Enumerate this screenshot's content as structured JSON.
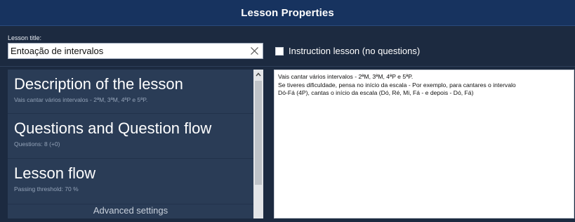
{
  "window": {
    "title": "Lesson Properties"
  },
  "lesson_title": {
    "label": "Lesson title:",
    "value": "Entoação de intervalos"
  },
  "instruction_lesson": {
    "label": "Instruction lesson (no questions)",
    "checked": false
  },
  "sections": [
    {
      "title": "Description of the lesson",
      "subtitle": "Vais cantar vários intervalos - 2ªM, 3ªM, 4ªP e 5ªP."
    },
    {
      "title": "Questions and Question flow",
      "subtitle": "Questions: 8 (+0)"
    },
    {
      "title": "Lesson flow",
      "subtitle": "Passing threshold: 70 %"
    }
  ],
  "advanced_settings_label": "Advanced settings",
  "description_lines": [
    "Vais cantar vários intervalos - 2ªM, 3ªM, 4ªP e 5ªP.",
    "Se tiveres dificuldade, pensa no início da escala - Por exemplo, para cantares o intervalo",
    "Dó-Fá (4P), cantas o início da escala (Dó, Ré, Mi, Fá - e depois - Dó, Fá)"
  ],
  "icons": {
    "clear": "close-icon",
    "scroll_up": "chevron-up-icon",
    "checkbox": "checkbox-unchecked-icon"
  },
  "colors": {
    "title_bar": "#17335f",
    "background": "#1c2a40",
    "panel": "#2a3c56"
  }
}
